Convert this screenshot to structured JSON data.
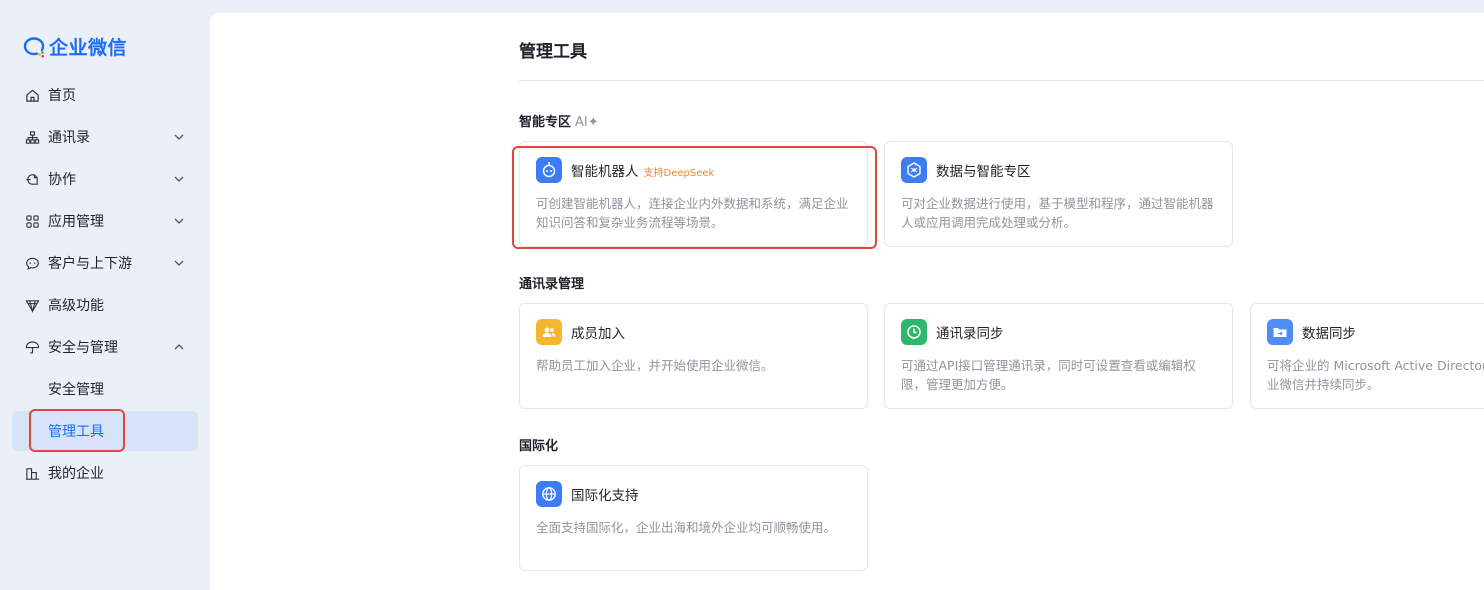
{
  "app": {
    "logo_text": "企业微信"
  },
  "sidebar": {
    "items": [
      {
        "label": "首页",
        "icon": "home-icon"
      },
      {
        "label": "通讯录",
        "icon": "org-chart-icon"
      },
      {
        "label": "协作",
        "icon": "collaboration-icon"
      },
      {
        "label": "应用管理",
        "icon": "apps-grid-icon"
      },
      {
        "label": "客户与上下游",
        "icon": "chat-bubble-icon"
      },
      {
        "label": "高级功能",
        "icon": "diamond-icon"
      },
      {
        "label": "安全与管理",
        "icon": "umbrella-icon"
      },
      {
        "label": "安全管理"
      },
      {
        "label": "管理工具"
      },
      {
        "label": "我的企业",
        "icon": "building-icon"
      }
    ],
    "active_item": "管理工具"
  },
  "main": {
    "title": "管理工具",
    "sections": [
      {
        "title": "智能专区",
        "badge": "AI✦",
        "cards": [
          {
            "title": "智能机器人",
            "tag": "支持DeepSeek",
            "desc": "可创建智能机器人，连接企业内外数据和系统，满足企业知识问答和复杂业务流程等场景。",
            "icon": "robot-icon",
            "color": "#3d7cf4"
          },
          {
            "title": "数据与智能专区",
            "desc": "可对企业数据进行使用，基于模型和程序，通过智能机器人或应用调用完成处理或分析。",
            "icon": "data-zone-icon",
            "color": "#3d7cf4"
          }
        ]
      },
      {
        "title": "通讯录管理",
        "cards": [
          {
            "title": "成员加入",
            "desc": "帮助员工加入企业，并开始使用企业微信。",
            "icon": "members-icon",
            "color": "#f3b72e"
          },
          {
            "title": "通讯录同步",
            "desc": "可通过API接口管理通讯录，同时可设置查看或编辑权限，管理更加方便。",
            "icon": "sync-icon",
            "color": "#2fb86b"
          },
          {
            "title": "数据同步",
            "desc": "可将企业的 Microsoft Active Directory 数据导入至企业微信并持续同步。",
            "icon": "folder-sync-icon",
            "color": "#4c8df6"
          }
        ]
      },
      {
        "title": "国际化",
        "cards": [
          {
            "title": "国际化支持",
            "desc": "全面支持国际化，企业出海和境外企业均可顺畅使用。",
            "icon": "globe-icon",
            "color": "#3d7cf4"
          }
        ]
      }
    ]
  },
  "colors": {
    "accent": "#1a6ef5",
    "highlight": "#e0463d",
    "tag": "#f08a24"
  }
}
